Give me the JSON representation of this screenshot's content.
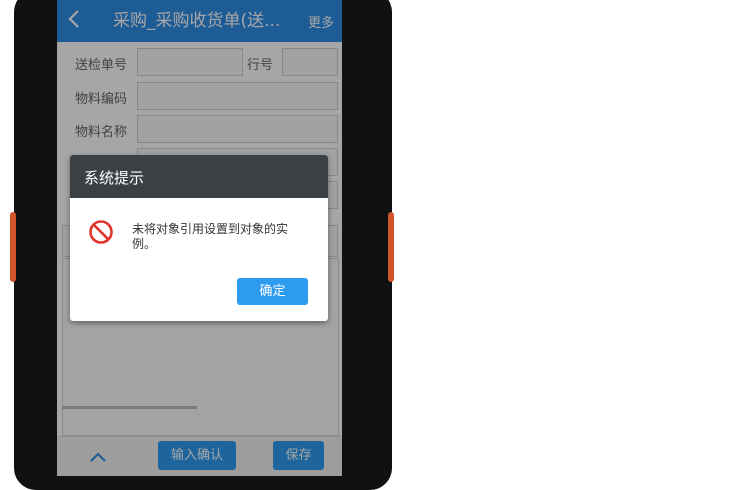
{
  "header": {
    "title": "采购_采购收货单(送...",
    "more": "更多"
  },
  "form": {
    "inspection_no_label": "送检单号",
    "line_no_label": "行号",
    "material_code_label": "物料编码",
    "material_name_label": "物料名称"
  },
  "bottom": {
    "confirm_input": "输入确认",
    "save": "保存"
  },
  "dialog": {
    "title": "系统提示",
    "message": "未将对象引用设置到对象的实例。",
    "ok": "确定"
  },
  "icons": {
    "back": "chevron-left-icon",
    "up": "chevron-up-icon",
    "error": "prohibited-icon"
  },
  "colors": {
    "accent": "#2f8ee6",
    "button": "#2d9bf0",
    "dialog_header": "#3b4045",
    "error": "#e0342c"
  }
}
